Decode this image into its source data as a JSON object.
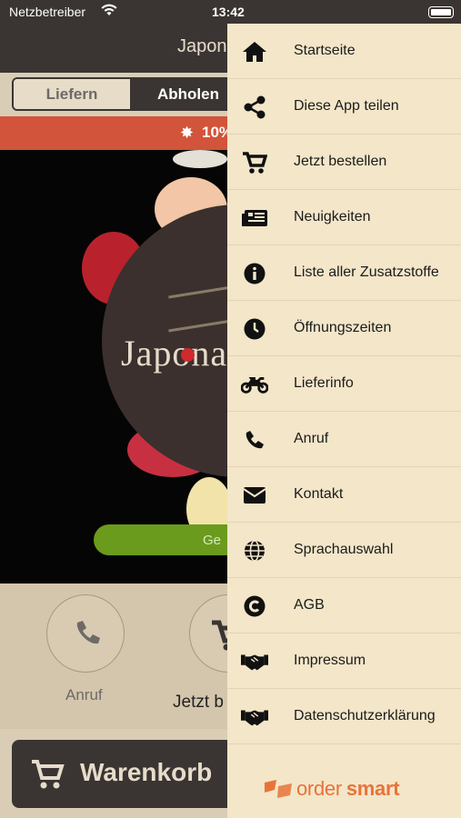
{
  "status_bar": {
    "carrier": "Netzbetreiber",
    "time": "13:42"
  },
  "header": {
    "title": "Japon"
  },
  "order_mode": {
    "options": [
      "Liefern",
      "Abholen"
    ],
    "selected": "Liefern"
  },
  "promo": {
    "text": "10%"
  },
  "hero": {
    "logo_text": "Japona",
    "order_button_label": "Ge"
  },
  "actions": {
    "call_label": "Anruf",
    "order_label": "Jetzt b"
  },
  "cart": {
    "label": "Warenkorb"
  },
  "drawer": {
    "items": [
      {
        "label": "Startseite",
        "icon": "home-icon"
      },
      {
        "label": "Diese App teilen",
        "icon": "share-icon"
      },
      {
        "label": "Jetzt bestellen",
        "icon": "cart-icon"
      },
      {
        "label": "Neuigkeiten",
        "icon": "news-icon"
      },
      {
        "label": "Liste aller Zusatzstoffe",
        "icon": "info-icon"
      },
      {
        "label": "Öffnungszeiten",
        "icon": "clock-icon"
      },
      {
        "label": "Lieferinfo",
        "icon": "motorcycle-icon"
      },
      {
        "label": "Anruf",
        "icon": "phone-icon"
      },
      {
        "label": "Kontakt",
        "icon": "envelope-icon"
      },
      {
        "label": "Sprachauswahl",
        "icon": "globe-icon"
      },
      {
        "label": "AGB",
        "icon": "copyright-icon"
      },
      {
        "label": "Impressum",
        "icon": "handshake-icon"
      },
      {
        "label": "Datenschutzerklärung",
        "icon": "handshake-icon"
      }
    ],
    "brand": {
      "part1": "order",
      "part2": "smart"
    }
  },
  "colors": {
    "accent": "#d2543a",
    "dark": "#3a3532",
    "drawer_bg": "#f3e6c9",
    "brand_orange": "#e8733a",
    "green": "#6b9b1c"
  }
}
